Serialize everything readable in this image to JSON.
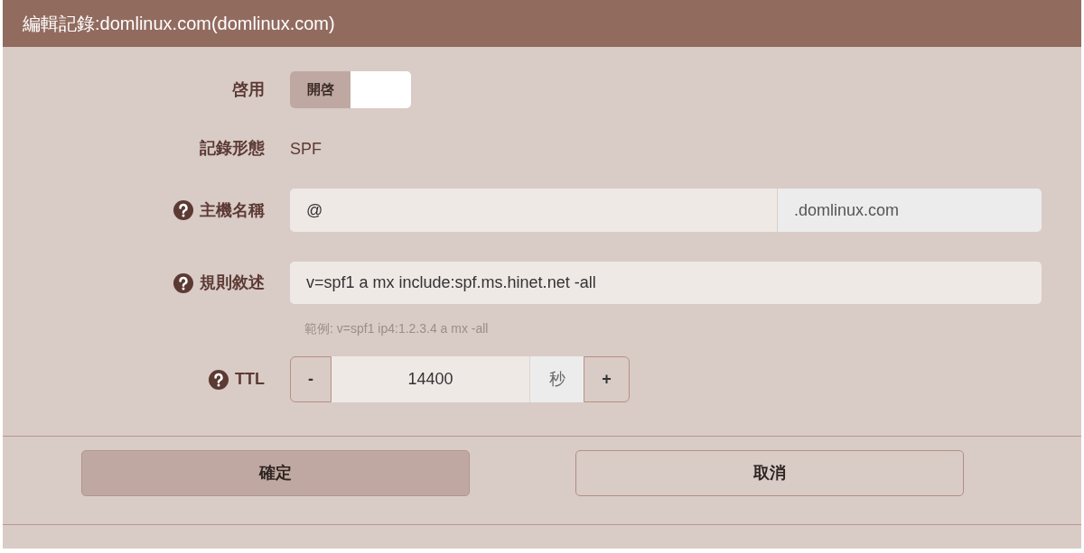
{
  "dialog": {
    "title": "編輯記錄:domlinux.com(domlinux.com)"
  },
  "fields": [
    {
      "kind": "toggle",
      "label": "啓用",
      "help": false,
      "on_label": "開啓",
      "on": true
    },
    {
      "kind": "static",
      "label": "記錄形態",
      "help": false,
      "value": "SPF"
    },
    {
      "kind": "text_suffix",
      "label": "主機名稱",
      "help": true,
      "value": "@",
      "suffix": ".domlinux.com"
    },
    {
      "kind": "text",
      "label": "規則敘述",
      "help": true,
      "value": "v=spf1 a mx include:spf.ms.hinet.net -all",
      "hint": "範例: v=spf1 ip4:1.2.3.4 a mx -all"
    },
    {
      "kind": "stepper",
      "label": "TTL",
      "help": true,
      "value": "14400",
      "unit": "秒",
      "decrement": "-",
      "increment": "+"
    }
  ],
  "buttons": [
    {
      "label": "確定",
      "kind": "primary"
    },
    {
      "label": "取消",
      "kind": "secondary"
    }
  ]
}
